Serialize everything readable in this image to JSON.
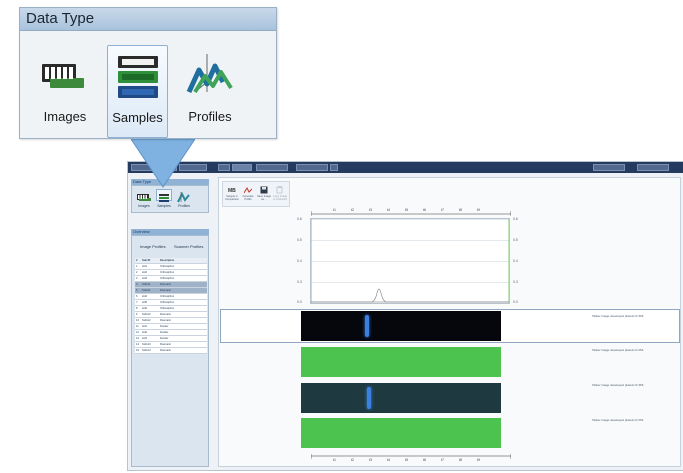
{
  "callout": {
    "title": "Data Type",
    "options": [
      {
        "label": "Images",
        "icon": "images-icon",
        "selected": false
      },
      {
        "label": "Samples",
        "icon": "samples-icon",
        "selected": true
      },
      {
        "label": "Profiles",
        "icon": "profiles-icon",
        "selected": false
      }
    ]
  },
  "app": {
    "topbar": {
      "buttons": [
        "",
        "",
        "",
        "",
        "",
        "",
        "",
        ""
      ],
      "right_buttons": [
        "",
        ""
      ]
    },
    "left_panel": {
      "data_type_header": "Data Type",
      "data_type_options": [
        "Images",
        "Samples",
        "Profiles"
      ],
      "overview_header": "Overview",
      "subtabs": [
        "Image Profiles",
        "Scanner Profiles"
      ],
      "table_headers": [
        "#",
        "Sub ID",
        "Description"
      ],
      "rows": [
        {
          "n": "1",
          "id": "std1",
          "desc": "Orthosiphon",
          "sel": false
        },
        {
          "n": "2",
          "id": "std2",
          "desc": "Orthosiphon",
          "sel": false
        },
        {
          "n": "3",
          "id": "std3",
          "desc": "Orthosiphon",
          "sel": false
        },
        {
          "n": "4",
          "id": "SHG11",
          "desc": "Rosmarin",
          "sel": true
        },
        {
          "n": "5",
          "id": "SHG11",
          "desc": "Rosmarin",
          "sel": true
        },
        {
          "n": "6",
          "id": "std4",
          "desc": "Orthosiphon",
          "sel": false
        },
        {
          "n": "7",
          "id": "std5",
          "desc": "Orthosiphon",
          "sel": false
        },
        {
          "n": "8",
          "id": "std6",
          "desc": "Orthosiphon",
          "sel": false
        },
        {
          "n": "9",
          "id": "SHG12",
          "desc": "Rosmarin",
          "sel": false
        },
        {
          "n": "10",
          "id": "SHG12",
          "desc": "Rosmarin",
          "sel": false
        },
        {
          "n": "11",
          "id": "std1",
          "desc": "Dunker",
          "sel": false
        },
        {
          "n": "12",
          "id": "std2",
          "desc": "Dunker",
          "sel": false
        },
        {
          "n": "13",
          "id": "std3",
          "desc": "Dunker",
          "sel": false
        },
        {
          "n": "14",
          "id": "SHG13",
          "desc": "Rosmarin",
          "sel": false
        },
        {
          "n": "15",
          "id": "SHG13",
          "desc": "Rosmarin",
          "sel": false
        }
      ]
    },
    "toolbar": {
      "tools": [
        {
          "label": "Sample in Comparison",
          "icon": "compare-icon"
        },
        {
          "label": "Generate Profile",
          "icon": "profile-icon"
        },
        {
          "label": "Save Image as ...",
          "icon": "save-icon"
        },
        {
          "label": "Copy Image to Clipboard",
          "icon": "copy-icon"
        }
      ]
    },
    "ruler_ticks": [
      "t1",
      "t2",
      "t3",
      "t4",
      "t5",
      "t6",
      "t7",
      "t8",
      "t9"
    ],
    "y_ticks_left": [
      "0.6",
      "0.5",
      "0.4",
      "0.3",
      "0.2",
      "0.1",
      "0.0"
    ],
    "y_ticks_right": [
      "0.6",
      "0.5",
      "0.4",
      "0.3",
      "0.2",
      "0.1",
      "0.0"
    ],
    "lanes": [
      {
        "caption": "Tallow image developed plate1c R 366",
        "style": "dark"
      },
      {
        "caption": "Tallow image developed plate1c R 254",
        "style": "green"
      },
      {
        "caption": "Tallow image developed plate1c R 366",
        "style": "teal"
      },
      {
        "caption": "Tallow image developed plate1c R 254",
        "style": "green"
      }
    ],
    "colors": {
      "accent": "#243a5e",
      "lane_green": "#4cc24f",
      "band_blue": "#3b7fe0"
    }
  }
}
